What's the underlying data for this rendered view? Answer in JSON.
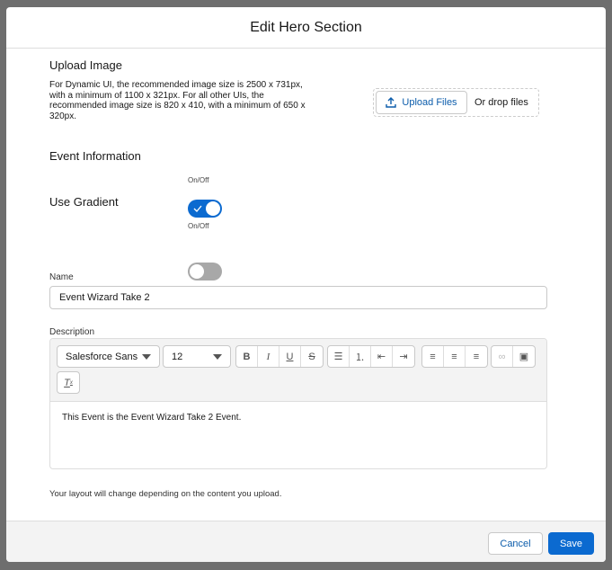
{
  "modal": {
    "title": "Edit Hero Section"
  },
  "upload": {
    "heading": "Upload Image",
    "help": "For Dynamic UI, the recommended image size is 2500 x 731px, with a minimum of 1100 x 321px. For all other UIs, the recommended image size is 820 x 410, with a minimum of 650 x 320px.",
    "button": "Upload Files",
    "drop": "Or drop files"
  },
  "event_info": {
    "label": "Event Information",
    "toggle_label": "On/Off",
    "checked": true
  },
  "gradient": {
    "label": "Use Gradient",
    "toggle_label": "On/Off",
    "checked": false
  },
  "name": {
    "label": "Name",
    "value": "Event Wizard Take 2"
  },
  "description": {
    "label": "Description",
    "font": "Salesforce Sans",
    "size": "12",
    "text": "This Event is the Event Wizard Take 2 Event."
  },
  "note": "Your layout will change depending on the content you upload.",
  "footer": {
    "cancel": "Cancel",
    "save": "Save"
  },
  "colors": {
    "brand": "#0b6ad0",
    "link": "#0b5cab"
  }
}
